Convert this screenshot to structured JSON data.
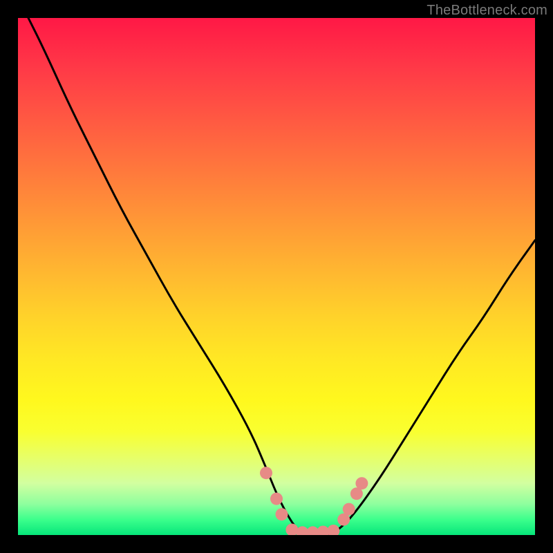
{
  "watermark": {
    "text": "TheBottleneck.com"
  },
  "chart_data": {
    "type": "line",
    "title": "",
    "xlabel": "",
    "ylabel": "",
    "xlim": [
      0,
      100
    ],
    "ylim": [
      0,
      100
    ],
    "grid": false,
    "legend": false,
    "series": [
      {
        "name": "bottleneck-curve",
        "color": "#000000",
        "x": [
          2,
          5,
          10,
          15,
          20,
          25,
          30,
          35,
          40,
          45,
          48,
          50,
          52,
          54,
          56,
          58,
          60,
          62,
          65,
          70,
          75,
          80,
          85,
          90,
          95,
          100
        ],
        "y": [
          100,
          94,
          83,
          73,
          63,
          54,
          45,
          37,
          29,
          20,
          13,
          8,
          4,
          1,
          0,
          0,
          0,
          1,
          4,
          11,
          19,
          27,
          35,
          42,
          50,
          57
        ]
      }
    ],
    "markers": {
      "name": "highlight-dots",
      "color": "#e78a86",
      "points": [
        {
          "x": 48,
          "y": 12
        },
        {
          "x": 50,
          "y": 7
        },
        {
          "x": 51,
          "y": 4
        },
        {
          "x": 53,
          "y": 1
        },
        {
          "x": 55,
          "y": 0.5
        },
        {
          "x": 57,
          "y": 0.5
        },
        {
          "x": 59,
          "y": 0.6
        },
        {
          "x": 61,
          "y": 0.8
        },
        {
          "x": 63,
          "y": 3
        },
        {
          "x": 64,
          "y": 5
        },
        {
          "x": 65.5,
          "y": 8
        },
        {
          "x": 66.5,
          "y": 10
        }
      ]
    },
    "gradient_stops": [
      {
        "pos": 0,
        "color": "#ff1846"
      },
      {
        "pos": 50,
        "color": "#ffba30"
      },
      {
        "pos": 80,
        "color": "#f9ff30"
      },
      {
        "pos": 100,
        "color": "#06e67a"
      }
    ]
  }
}
